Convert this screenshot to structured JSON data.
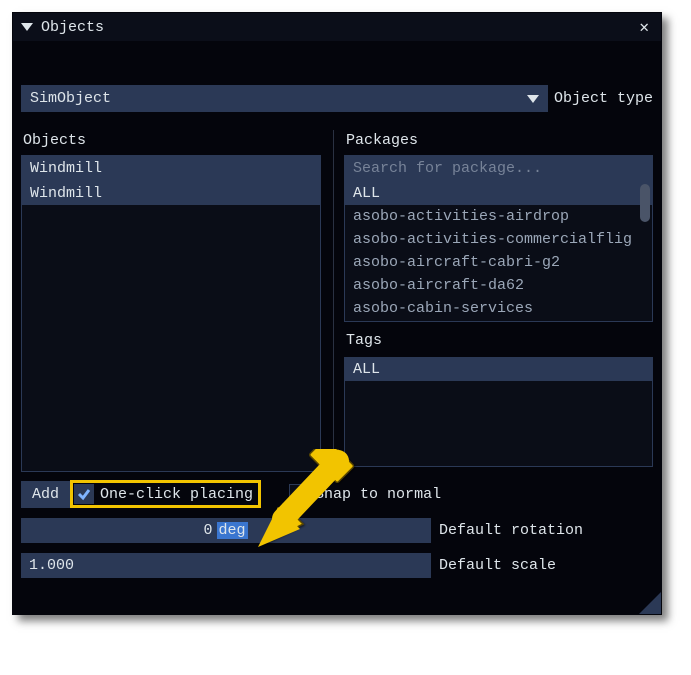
{
  "window": {
    "title": "Objects"
  },
  "object_type": {
    "value": "SimObject",
    "label": "Object type"
  },
  "objects": {
    "heading": "Objects",
    "filter_value": "Windmill",
    "items": [
      "Windmill"
    ],
    "selected_index": 0
  },
  "packages": {
    "heading": "Packages",
    "search_placeholder": "Search for package...",
    "items": [
      "ALL",
      "asobo-activities-airdrop",
      "asobo-activities-commercialflig",
      "asobo-aircraft-cabri-g2",
      "asobo-aircraft-da62",
      "asobo-cabin-services"
    ],
    "selected_index": 0
  },
  "tags": {
    "heading": "Tags",
    "items": [
      "ALL"
    ],
    "selected_index": 0
  },
  "controls": {
    "add_label": "Add",
    "one_click_label": "One-click placing",
    "one_click_checked": true,
    "snap_label": "Snap to normal",
    "snap_checked": false
  },
  "rotation": {
    "value": "0",
    "unit": "deg",
    "label": "Default rotation"
  },
  "scale": {
    "value": "1.000",
    "label": "Default scale"
  },
  "colors": {
    "accent": "#2b3956",
    "highlight": "#f2c400"
  }
}
